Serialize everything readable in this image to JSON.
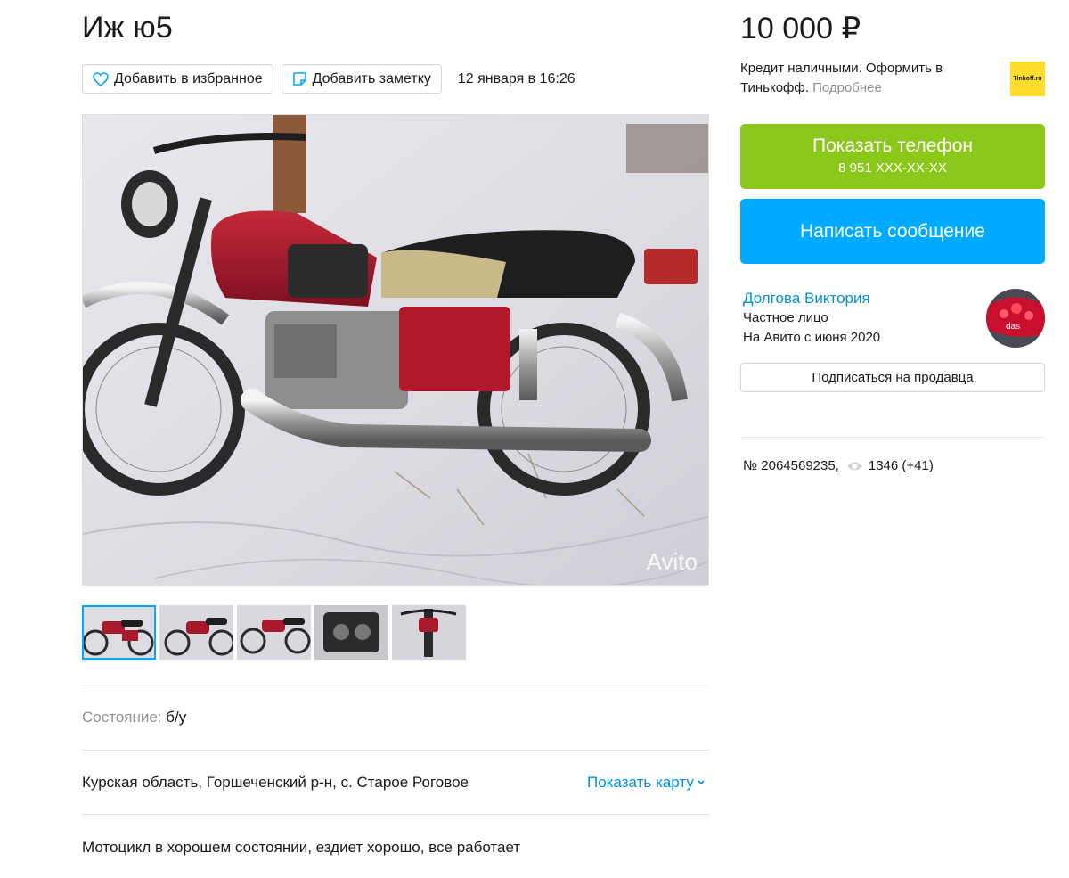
{
  "listing": {
    "title": "Иж ю5",
    "favorite_label": "Добавить в избранное",
    "note_label": "Добавить заметку",
    "date": "12 января в 16:26",
    "watermark": "Avito",
    "condition_key": "Состояние:",
    "condition_value": "б/у",
    "address": "Курская область, Горшеченский р-н, с. Старое Роговое",
    "show_map_label": "Показать карту",
    "description": "Мотоцикл в хорошем состоянии, ездиет хорошо, все работает"
  },
  "sidebar": {
    "price": "10 000 ₽",
    "promo_text": "Кредит наличными. Оформить в Тинькофф.",
    "promo_more": "Подробнее",
    "promo_logo": "Tinkoff.ru",
    "phone_label": "Показать телефон",
    "phone_masked": "8 951 XXX-XX-XX",
    "message_label": "Написать сообщение",
    "seller_name": "Долгова Виктория",
    "seller_type": "Частное лицо",
    "seller_since": "На Авито с июня 2020",
    "subscribe_label": "Подписаться на продавца",
    "item_number": "№ 2064569235,",
    "views": "1346 (+41)"
  },
  "colors": {
    "phone_button": "#8cc71c",
    "message_button": "#00aaff",
    "link": "#0091d9",
    "active_thumb": "#00aaff",
    "tinkoff_yellow": "#ffdd2d"
  },
  "icons": [
    "heart-icon",
    "note-icon",
    "chevron-down-icon",
    "eye-icon"
  ],
  "gallery": {
    "thumb_count": 5,
    "active_index": 0
  }
}
